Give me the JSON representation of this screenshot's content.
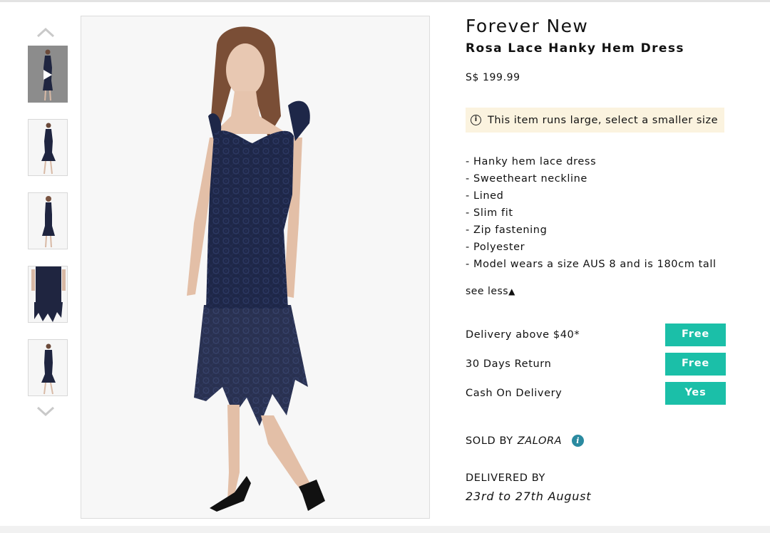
{
  "thumbnails": {
    "nav_up_icon": "chevron-up-icon",
    "nav_down_icon": "chevron-down-icon",
    "play_icon": "play-icon",
    "count": 5
  },
  "product": {
    "brand": "Forever New",
    "name": "Rosa Lace Hanky Hem Dress",
    "price": "S$ 199.99"
  },
  "size_notice": {
    "icon": "info-circle-icon",
    "icon_glyph": "i",
    "text": "This item runs large, select a smaller size",
    "background": "#fbf3df"
  },
  "features": [
    "- Hanky hem lace dress",
    "- Sweetheart neckline",
    "- Lined",
    "- Slim fit",
    "- Zip fastening",
    "- Polyester",
    "- Model wears a size AUS 8 and is 180cm tall"
  ],
  "see_less": {
    "label": "see less",
    "icon_glyph": "▲"
  },
  "services": [
    {
      "label": "Delivery above $40*",
      "badge": "Free"
    },
    {
      "label": "30 Days Return",
      "badge": "Free"
    },
    {
      "label": "Cash On Delivery",
      "badge": "Yes"
    }
  ],
  "badge_color": "#1bbfa8",
  "sold_by": {
    "label": "SOLD BY",
    "seller": "ZALORA",
    "info_glyph": "i",
    "info_color": "#2a8aa0"
  },
  "delivery": {
    "label": "DELIVERED BY",
    "dates": "23rd to 27th August"
  }
}
